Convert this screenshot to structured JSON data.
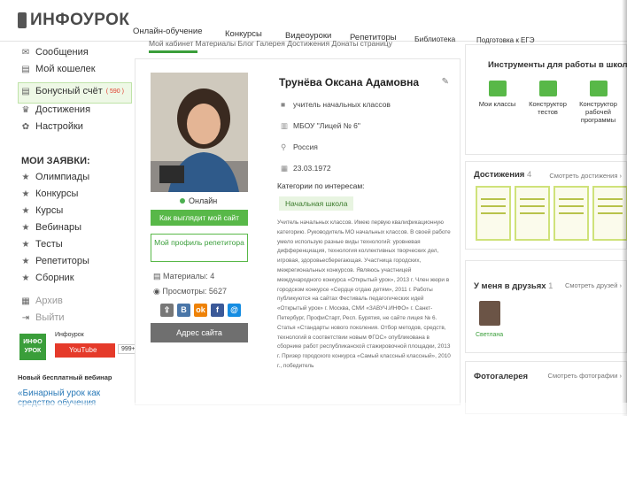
{
  "header": {
    "logo": "ИНФОУРОК",
    "nav": [
      "Онлайн-обучение",
      "Конкурсы",
      "Видеоуроки",
      "Репетиторы",
      "Библиотека",
      "Подготовка к ЕГЭ"
    ],
    "subnav": "Мой кабинет   Материалы   Блог   Галерея   Достижения   Донаты страницу"
  },
  "sidebar": {
    "items": [
      {
        "icon": "envelope-icon",
        "label": "Сообщения"
      },
      {
        "icon": "wallet-icon",
        "label": "Мой кошелек"
      },
      {
        "icon": "wallet-icon",
        "label": "Бонусный счёт",
        "badge": "( 590 )"
      },
      {
        "icon": "trophy-icon",
        "label": "Достижения"
      },
      {
        "icon": "gear-icon",
        "label": "Настройки"
      }
    ],
    "requests_heading": "МОИ ЗАЯВКИ:",
    "requests": [
      "Олимпиады",
      "Конкурсы",
      "Курсы",
      "Вебинары",
      "Тесты",
      "Репетиторы",
      "Сборник"
    ],
    "archive": "Архив",
    "logout": "Выйти",
    "youtube": {
      "logo": "ИНФО УРОК",
      "channel": "Инфоурок",
      "button": "YouTube",
      "count": "999+"
    },
    "webinar": {
      "heading": "Новый бесплатный вебинар",
      "link": "«Бинарный урок как средство обучения"
    }
  },
  "profile": {
    "status": "Онлайн",
    "site_button": "Как выглядит мой сайт",
    "tutor_button": "Мой профиль репетитора",
    "materials": "Материалы: 4",
    "views": "Просмотры: 5627",
    "address_button": "Адрес сайта",
    "name": "Трунёва Оксана Адамовна",
    "position": "учитель начальных классов",
    "school": "МБОУ \"Лицей № 6\"",
    "country": "Россия",
    "birthdate": "23.03.1972",
    "categories_heading": "Категории по интересам:",
    "category": "Начальная школа",
    "bio": "Учитель начальных классов. Имею первую квалификационную категорию. Руководитель МО начальных классов. В своей работе умело использую разные виды технологий: уровневая дифференциация, технология коллективных творческих дел, игровая, здоровьесберегающая. Участница городских, межрегиональных конкурсов. Являюсь участницей международного конкурса «Открытый урок», 2013 г. Член жюри в городском конкурсе «Сердце отдаю детям», 2011 г. Работы публикуются на сайтах Фестиваль педагогических идей «Открытый урок» г. Москва, СМИ «ЗАВУЧ.ИНФО» г. Санкт-Петербург, ПрофиСтарт, Респ. Бурятия, не сайте лицея № 6. Статья «Стандарты нового поколения. Отбор методов, средств, технологий в соответствии новым ФГОС» опубликована в сборнике работ республиканской стажировочной площадки, 2013 г. Призер городского конкурса «Самый классный классный», 2010 г., победитель"
  },
  "right": {
    "tools_heading": "Инструменты для работы в школе",
    "tools": [
      "Мои классы",
      "Конструктор тестов",
      "Конструктор рабочей программы"
    ],
    "achievements_heading": "Достижения",
    "achievements_count": "4",
    "achievements_link": "Смотреть достижения ›",
    "friends_heading": "У меня в друзьях",
    "friends_count": "1",
    "friends_link": "Смотреть друзей ›",
    "friend_name": "Светлана",
    "gallery_heading": "Фотогалерея",
    "gallery_link": "Смотреть фотографии ›"
  },
  "colors": {
    "accent": "#58b848",
    "badge": "#e03b2b",
    "link": "#2a7ab8"
  }
}
